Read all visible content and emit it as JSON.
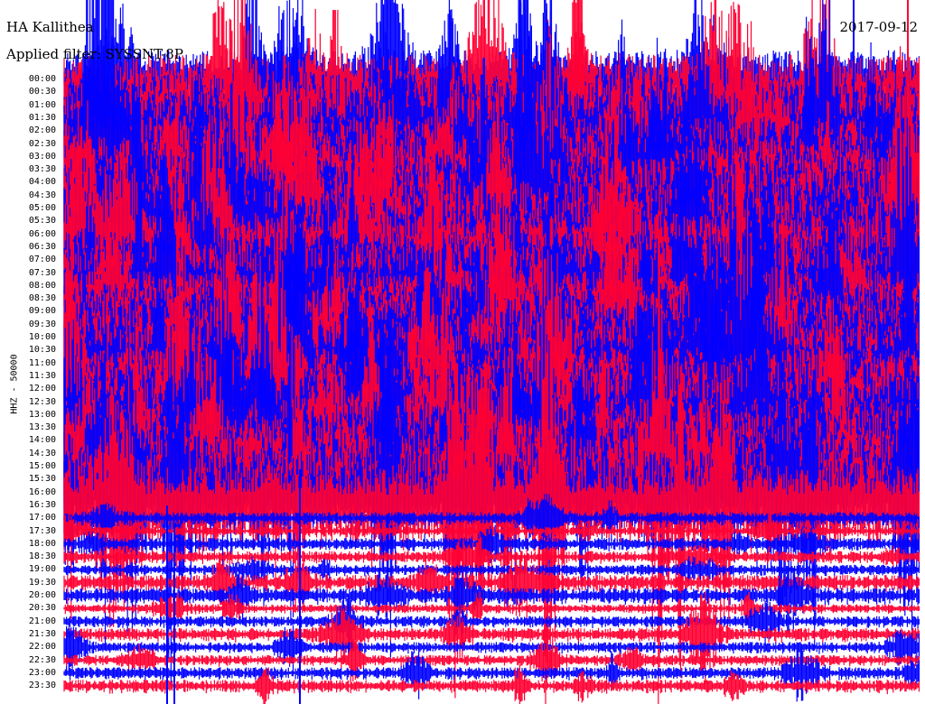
{
  "station": "HA Kallithea",
  "date": "2017-09-12",
  "filter_label": "Applied filter: SYSSNT-8P",
  "channel_label": "HHZ - 50000",
  "trace_colors": [
    "#0000ff",
    "#ff0033"
  ],
  "hours": [
    "00:00",
    "00:30",
    "01:00",
    "01:30",
    "02:00",
    "02:30",
    "03:00",
    "03:30",
    "04:00",
    "04:30",
    "05:00",
    "05:30",
    "06:00",
    "06:30",
    "07:00",
    "07:30",
    "08:00",
    "08:30",
    "09:00",
    "09:30",
    "10:00",
    "10:30",
    "11:00",
    "11:30",
    "12:00",
    "12:30",
    "13:00",
    "13:30",
    "14:00",
    "14:30",
    "15:00",
    "15:30",
    "16:00",
    "16:30",
    "17:00",
    "17:30",
    "18:00",
    "18:30",
    "19:00",
    "19:30",
    "20:00",
    "20:30",
    "21:00",
    "21:30",
    "22:00",
    "22:30",
    "23:00",
    "23:30"
  ]
}
